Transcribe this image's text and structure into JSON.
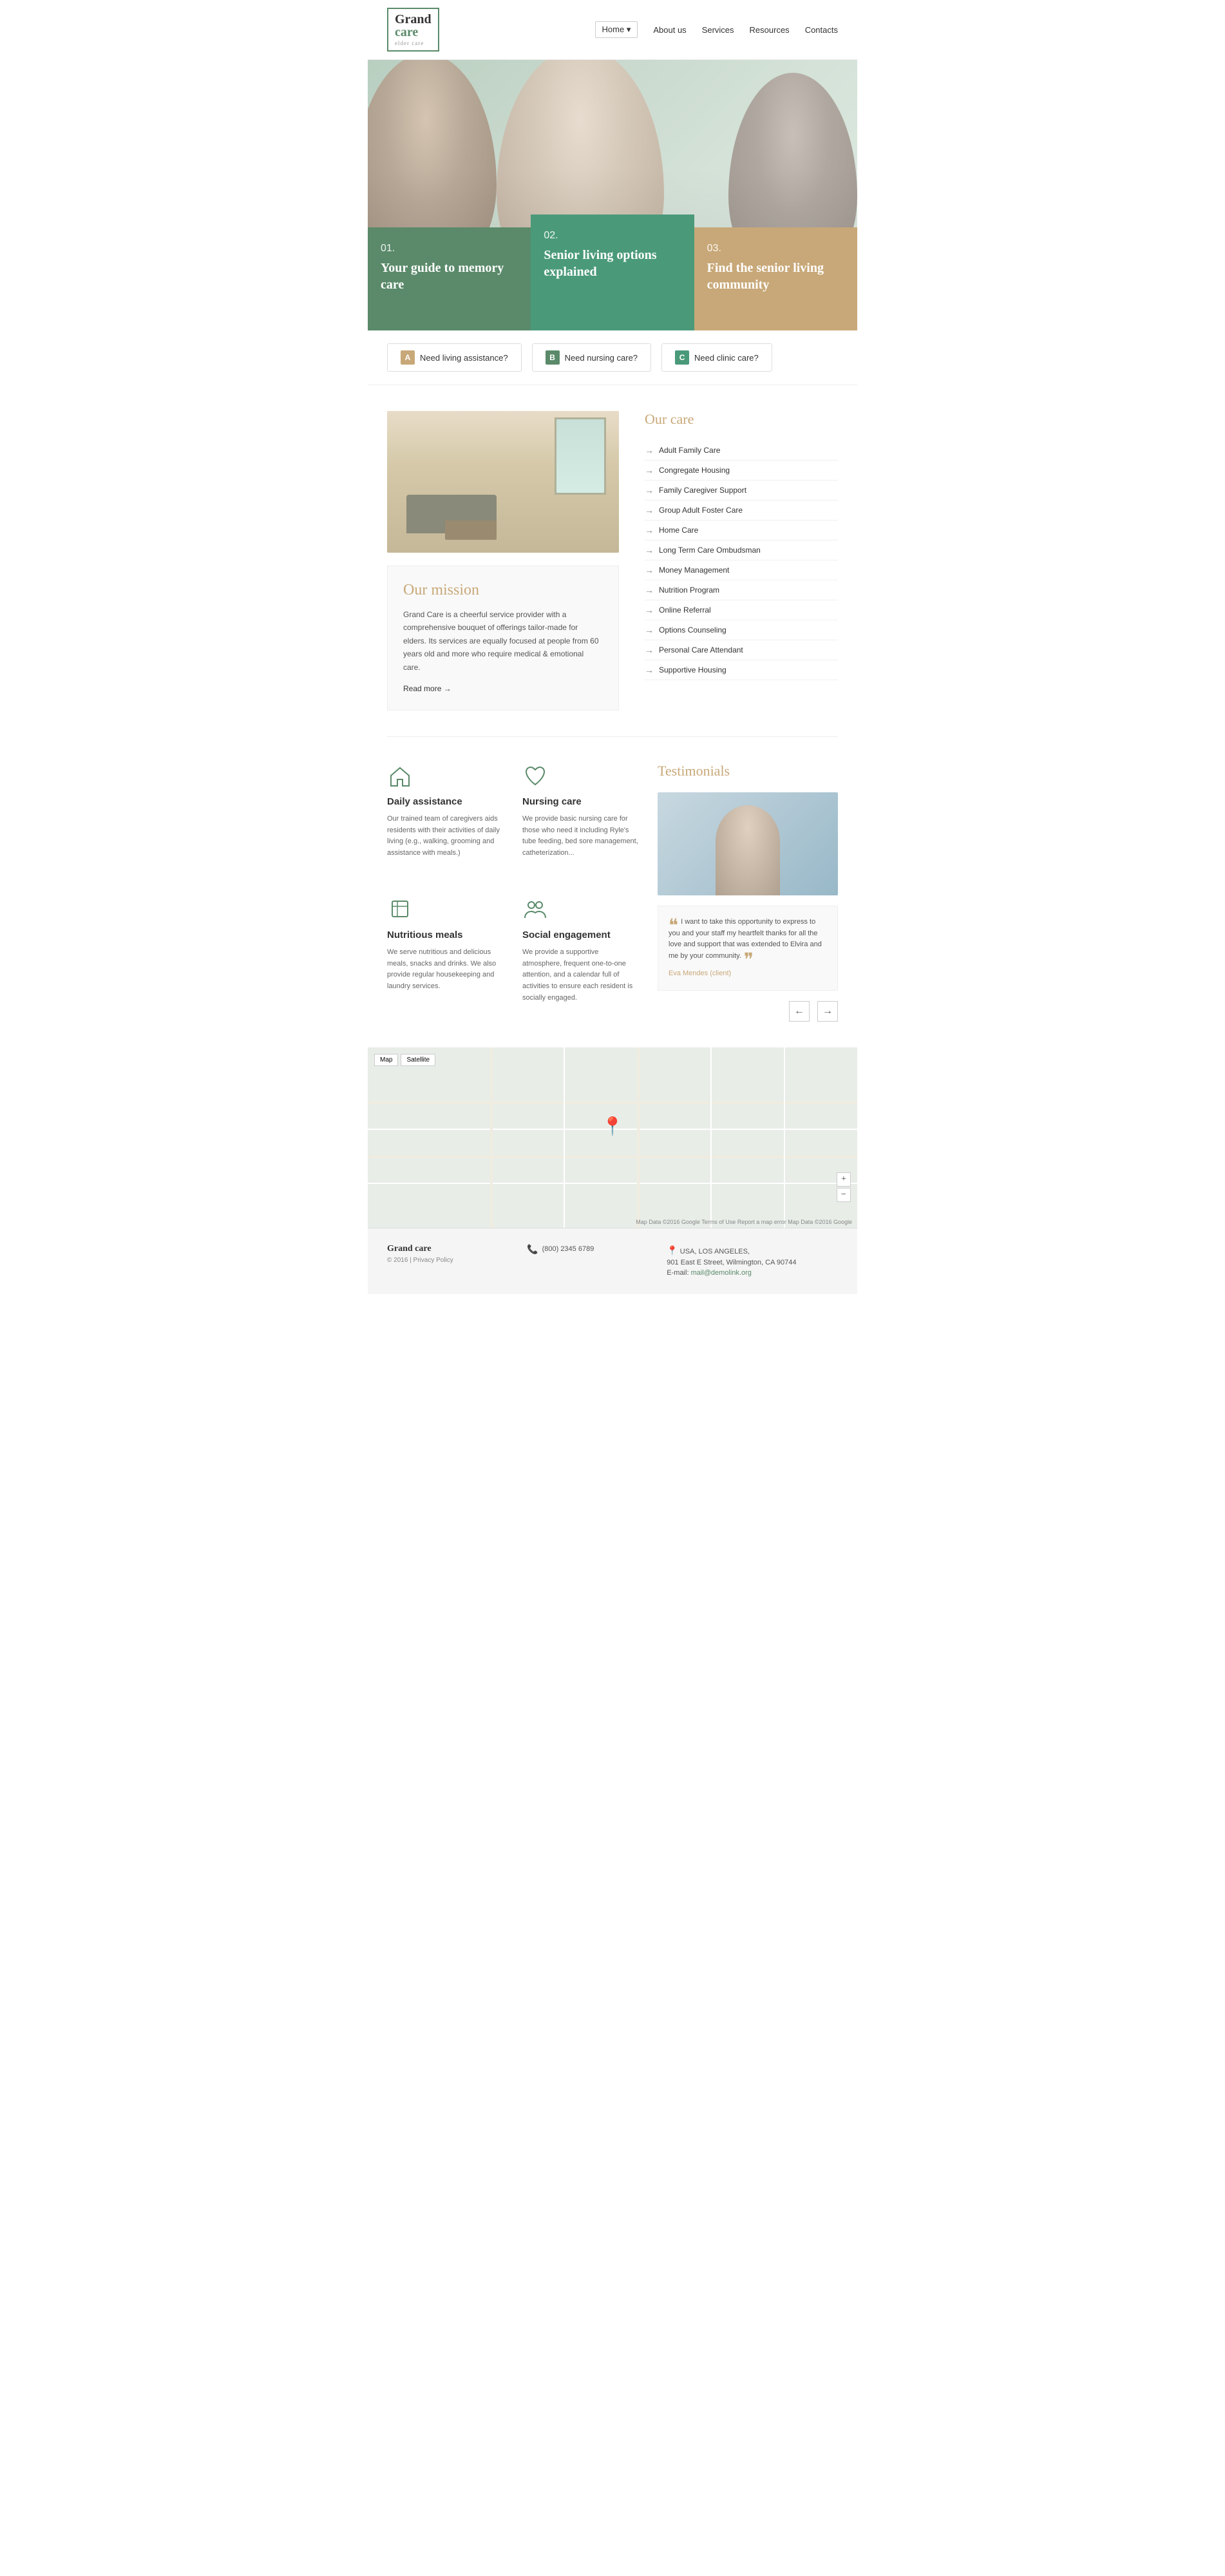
{
  "brand": {
    "name_grand": "Grand",
    "name_care": "care",
    "tagline": "elder care"
  },
  "nav": {
    "items": [
      {
        "label": "Home ▾",
        "id": "home",
        "active": true
      },
      {
        "label": "About us",
        "id": "about"
      },
      {
        "label": "Services",
        "id": "services"
      },
      {
        "label": "Resources",
        "id": "resources"
      },
      {
        "label": "Contacts",
        "id": "contacts"
      }
    ]
  },
  "hero": {
    "cards": [
      {
        "num": "01.",
        "title": "Your guide to memory care"
      },
      {
        "num": "02.",
        "title": "Senior living options explained"
      },
      {
        "num": "03.",
        "title": "Find the senior living community"
      }
    ]
  },
  "quick_links": [
    {
      "letter": "A",
      "text": "Need living assistance?",
      "color": "a"
    },
    {
      "letter": "B",
      "text": "Need nursing care?",
      "color": "b"
    },
    {
      "letter": "C",
      "text": "Need clinic care?",
      "color": "c"
    }
  ],
  "mission": {
    "title": "Our mission",
    "body": "Grand Care is a cheerful service provider with a comprehensive bouquet of offerings tailor-made for elders. Its services are equally focused at people from 60 years old and more who require medical & emotional care.",
    "read_more": "Read more"
  },
  "our_care": {
    "title": "Our care",
    "items": [
      "Adult Family Care",
      "Congregate Housing",
      "Family Caregiver Support",
      "Group Adult Foster Care",
      "Home Care",
      "Long Term Care Ombudsman",
      "Money Management",
      "Nutrition Program",
      "Online Referral",
      "Options Counseling",
      "Personal Care Attendant",
      "Supportive Housing"
    ]
  },
  "services": {
    "items": [
      {
        "icon": "home",
        "title": "Daily assistance",
        "text": "Our trained team of caregivers aids residents with their activities of daily living (e.g., walking, grooming and assistance with meals.)"
      },
      {
        "icon": "heart",
        "title": "Nursing care",
        "text": "We provide basic nursing care for those who need it including Ryle's tube feeding, bed sore management, catheterization..."
      },
      {
        "icon": "meals",
        "title": "Nutritious meals",
        "text": "We serve nutritious and delicious meals, snacks and drinks. We also provide regular housekeeping and laundry services."
      },
      {
        "icon": "social",
        "title": "Social engagement",
        "text": "We provide a supportive atmosphere, frequent one-to-one attention, and a calendar full of activities to ensure each resident is socially engaged."
      }
    ]
  },
  "testimonials": {
    "title": "Testimonials",
    "quote": "I want to take this opportunity to express to you and your staff my heartfelt thanks for all the love and support that was extended to Elvira and me by your community.",
    "author": "Eva Mendes (client)"
  },
  "map": {
    "map_btn": "Map",
    "satellite_btn": "Satellite",
    "attribution": "Map Data ©2016 Google   Terms of Use   Report a map error   Map Data ©2016 Google"
  },
  "footer": {
    "brand": "Grand care",
    "copyright": "© 2016 | Privacy Policy",
    "phone_icon": "📞",
    "phone": "(800) 2345 6789",
    "location_icon": "📍",
    "address_line1": "USA, LOS ANGELES,",
    "address_line2": "901 East E Street, Wilmington, CA 90744",
    "email_label": "E-mail:",
    "email": "mail@demolink.org"
  }
}
